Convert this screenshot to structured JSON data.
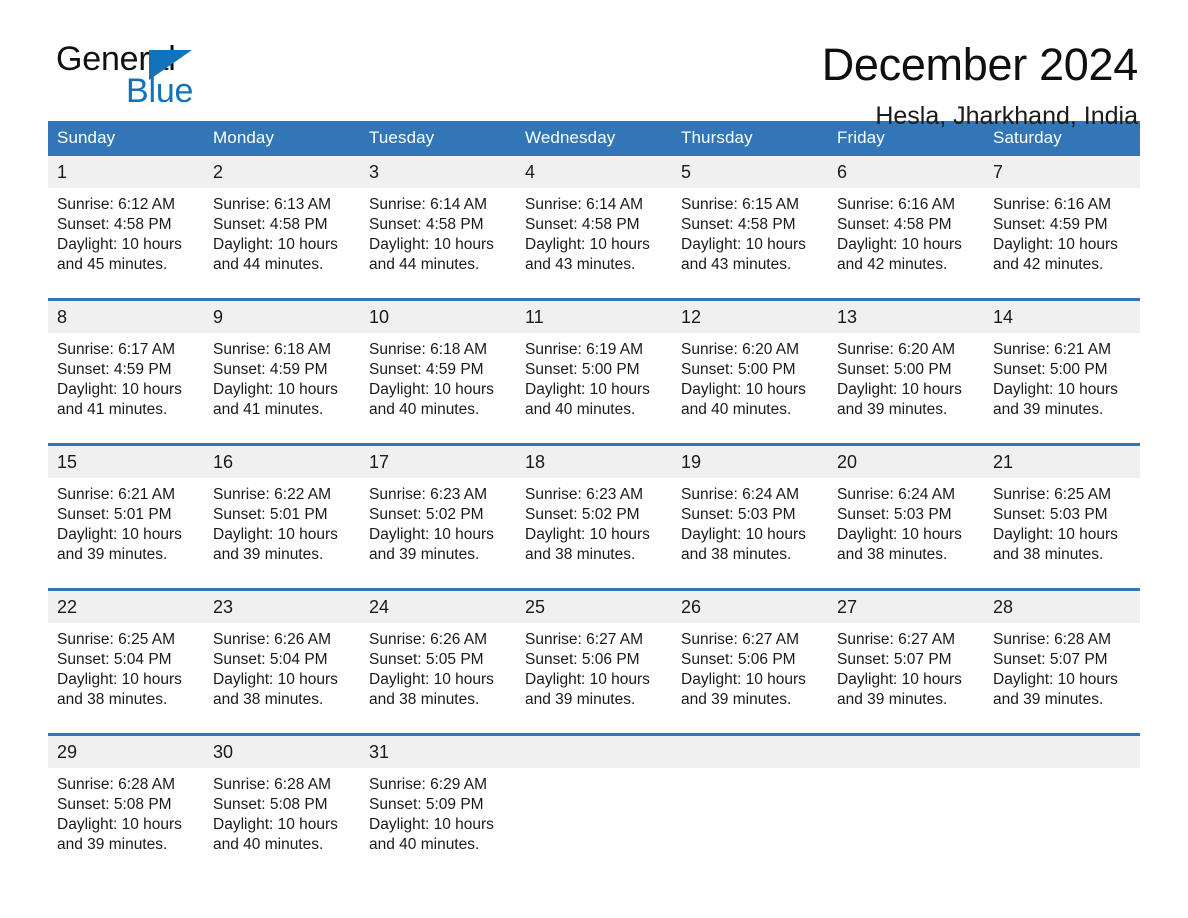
{
  "brand": {
    "name_part1": "General",
    "name_part2": "Blue",
    "triangle_color": "#1272BA"
  },
  "header": {
    "title": "December 2024",
    "subtitle": "Hesla, Jharkhand, India"
  },
  "theme": {
    "header_blue": "#3276B8",
    "daynum_band": "#F0F0F0",
    "text": "#1a1a1a",
    "page_background": "#ffffff"
  },
  "weekdays": [
    "Sunday",
    "Monday",
    "Tuesday",
    "Wednesday",
    "Thursday",
    "Friday",
    "Saturday"
  ],
  "calendar": {
    "month": "December",
    "year": "2024",
    "location": "Hesla, Jharkhand, India",
    "weeks": [
      [
        {
          "day": "1",
          "sunrise": "Sunrise: 6:12 AM",
          "sunset": "Sunset: 4:58 PM",
          "daylight_1": "Daylight: 10 hours",
          "daylight_2": "and 45 minutes."
        },
        {
          "day": "2",
          "sunrise": "Sunrise: 6:13 AM",
          "sunset": "Sunset: 4:58 PM",
          "daylight_1": "Daylight: 10 hours",
          "daylight_2": "and 44 minutes."
        },
        {
          "day": "3",
          "sunrise": "Sunrise: 6:14 AM",
          "sunset": "Sunset: 4:58 PM",
          "daylight_1": "Daylight: 10 hours",
          "daylight_2": "and 44 minutes."
        },
        {
          "day": "4",
          "sunrise": "Sunrise: 6:14 AM",
          "sunset": "Sunset: 4:58 PM",
          "daylight_1": "Daylight: 10 hours",
          "daylight_2": "and 43 minutes."
        },
        {
          "day": "5",
          "sunrise": "Sunrise: 6:15 AM",
          "sunset": "Sunset: 4:58 PM",
          "daylight_1": "Daylight: 10 hours",
          "daylight_2": "and 43 minutes."
        },
        {
          "day": "6",
          "sunrise": "Sunrise: 6:16 AM",
          "sunset": "Sunset: 4:58 PM",
          "daylight_1": "Daylight: 10 hours",
          "daylight_2": "and 42 minutes."
        },
        {
          "day": "7",
          "sunrise": "Sunrise: 6:16 AM",
          "sunset": "Sunset: 4:59 PM",
          "daylight_1": "Daylight: 10 hours",
          "daylight_2": "and 42 minutes."
        }
      ],
      [
        {
          "day": "8",
          "sunrise": "Sunrise: 6:17 AM",
          "sunset": "Sunset: 4:59 PM",
          "daylight_1": "Daylight: 10 hours",
          "daylight_2": "and 41 minutes."
        },
        {
          "day": "9",
          "sunrise": "Sunrise: 6:18 AM",
          "sunset": "Sunset: 4:59 PM",
          "daylight_1": "Daylight: 10 hours",
          "daylight_2": "and 41 minutes."
        },
        {
          "day": "10",
          "sunrise": "Sunrise: 6:18 AM",
          "sunset": "Sunset: 4:59 PM",
          "daylight_1": "Daylight: 10 hours",
          "daylight_2": "and 40 minutes."
        },
        {
          "day": "11",
          "sunrise": "Sunrise: 6:19 AM",
          "sunset": "Sunset: 5:00 PM",
          "daylight_1": "Daylight: 10 hours",
          "daylight_2": "and 40 minutes."
        },
        {
          "day": "12",
          "sunrise": "Sunrise: 6:20 AM",
          "sunset": "Sunset: 5:00 PM",
          "daylight_1": "Daylight: 10 hours",
          "daylight_2": "and 40 minutes."
        },
        {
          "day": "13",
          "sunrise": "Sunrise: 6:20 AM",
          "sunset": "Sunset: 5:00 PM",
          "daylight_1": "Daylight: 10 hours",
          "daylight_2": "and 39 minutes."
        },
        {
          "day": "14",
          "sunrise": "Sunrise: 6:21 AM",
          "sunset": "Sunset: 5:00 PM",
          "daylight_1": "Daylight: 10 hours",
          "daylight_2": "and 39 minutes."
        }
      ],
      [
        {
          "day": "15",
          "sunrise": "Sunrise: 6:21 AM",
          "sunset": "Sunset: 5:01 PM",
          "daylight_1": "Daylight: 10 hours",
          "daylight_2": "and 39 minutes."
        },
        {
          "day": "16",
          "sunrise": "Sunrise: 6:22 AM",
          "sunset": "Sunset: 5:01 PM",
          "daylight_1": "Daylight: 10 hours",
          "daylight_2": "and 39 minutes."
        },
        {
          "day": "17",
          "sunrise": "Sunrise: 6:23 AM",
          "sunset": "Sunset: 5:02 PM",
          "daylight_1": "Daylight: 10 hours",
          "daylight_2": "and 39 minutes."
        },
        {
          "day": "18",
          "sunrise": "Sunrise: 6:23 AM",
          "sunset": "Sunset: 5:02 PM",
          "daylight_1": "Daylight: 10 hours",
          "daylight_2": "and 38 minutes."
        },
        {
          "day": "19",
          "sunrise": "Sunrise: 6:24 AM",
          "sunset": "Sunset: 5:03 PM",
          "daylight_1": "Daylight: 10 hours",
          "daylight_2": "and 38 minutes."
        },
        {
          "day": "20",
          "sunrise": "Sunrise: 6:24 AM",
          "sunset": "Sunset: 5:03 PM",
          "daylight_1": "Daylight: 10 hours",
          "daylight_2": "and 38 minutes."
        },
        {
          "day": "21",
          "sunrise": "Sunrise: 6:25 AM",
          "sunset": "Sunset: 5:03 PM",
          "daylight_1": "Daylight: 10 hours",
          "daylight_2": "and 38 minutes."
        }
      ],
      [
        {
          "day": "22",
          "sunrise": "Sunrise: 6:25 AM",
          "sunset": "Sunset: 5:04 PM",
          "daylight_1": "Daylight: 10 hours",
          "daylight_2": "and 38 minutes."
        },
        {
          "day": "23",
          "sunrise": "Sunrise: 6:26 AM",
          "sunset": "Sunset: 5:04 PM",
          "daylight_1": "Daylight: 10 hours",
          "daylight_2": "and 38 minutes."
        },
        {
          "day": "24",
          "sunrise": "Sunrise: 6:26 AM",
          "sunset": "Sunset: 5:05 PM",
          "daylight_1": "Daylight: 10 hours",
          "daylight_2": "and 38 minutes."
        },
        {
          "day": "25",
          "sunrise": "Sunrise: 6:27 AM",
          "sunset": "Sunset: 5:06 PM",
          "daylight_1": "Daylight: 10 hours",
          "daylight_2": "and 39 minutes."
        },
        {
          "day": "26",
          "sunrise": "Sunrise: 6:27 AM",
          "sunset": "Sunset: 5:06 PM",
          "daylight_1": "Daylight: 10 hours",
          "daylight_2": "and 39 minutes."
        },
        {
          "day": "27",
          "sunrise": "Sunrise: 6:27 AM",
          "sunset": "Sunset: 5:07 PM",
          "daylight_1": "Daylight: 10 hours",
          "daylight_2": "and 39 minutes."
        },
        {
          "day": "28",
          "sunrise": "Sunrise: 6:28 AM",
          "sunset": "Sunset: 5:07 PM",
          "daylight_1": "Daylight: 10 hours",
          "daylight_2": "and 39 minutes."
        }
      ],
      [
        {
          "day": "29",
          "sunrise": "Sunrise: 6:28 AM",
          "sunset": "Sunset: 5:08 PM",
          "daylight_1": "Daylight: 10 hours",
          "daylight_2": "and 39 minutes."
        },
        {
          "day": "30",
          "sunrise": "Sunrise: 6:28 AM",
          "sunset": "Sunset: 5:08 PM",
          "daylight_1": "Daylight: 10 hours",
          "daylight_2": "and 40 minutes."
        },
        {
          "day": "31",
          "sunrise": "Sunrise: 6:29 AM",
          "sunset": "Sunset: 5:09 PM",
          "daylight_1": "Daylight: 10 hours",
          "daylight_2": "and 40 minutes."
        },
        {
          "day": "",
          "sunrise": "",
          "sunset": "",
          "daylight_1": "",
          "daylight_2": ""
        },
        {
          "day": "",
          "sunrise": "",
          "sunset": "",
          "daylight_1": "",
          "daylight_2": ""
        },
        {
          "day": "",
          "sunrise": "",
          "sunset": "",
          "daylight_1": "",
          "daylight_2": ""
        },
        {
          "day": "",
          "sunrise": "",
          "sunset": "",
          "daylight_1": "",
          "daylight_2": ""
        }
      ]
    ]
  }
}
